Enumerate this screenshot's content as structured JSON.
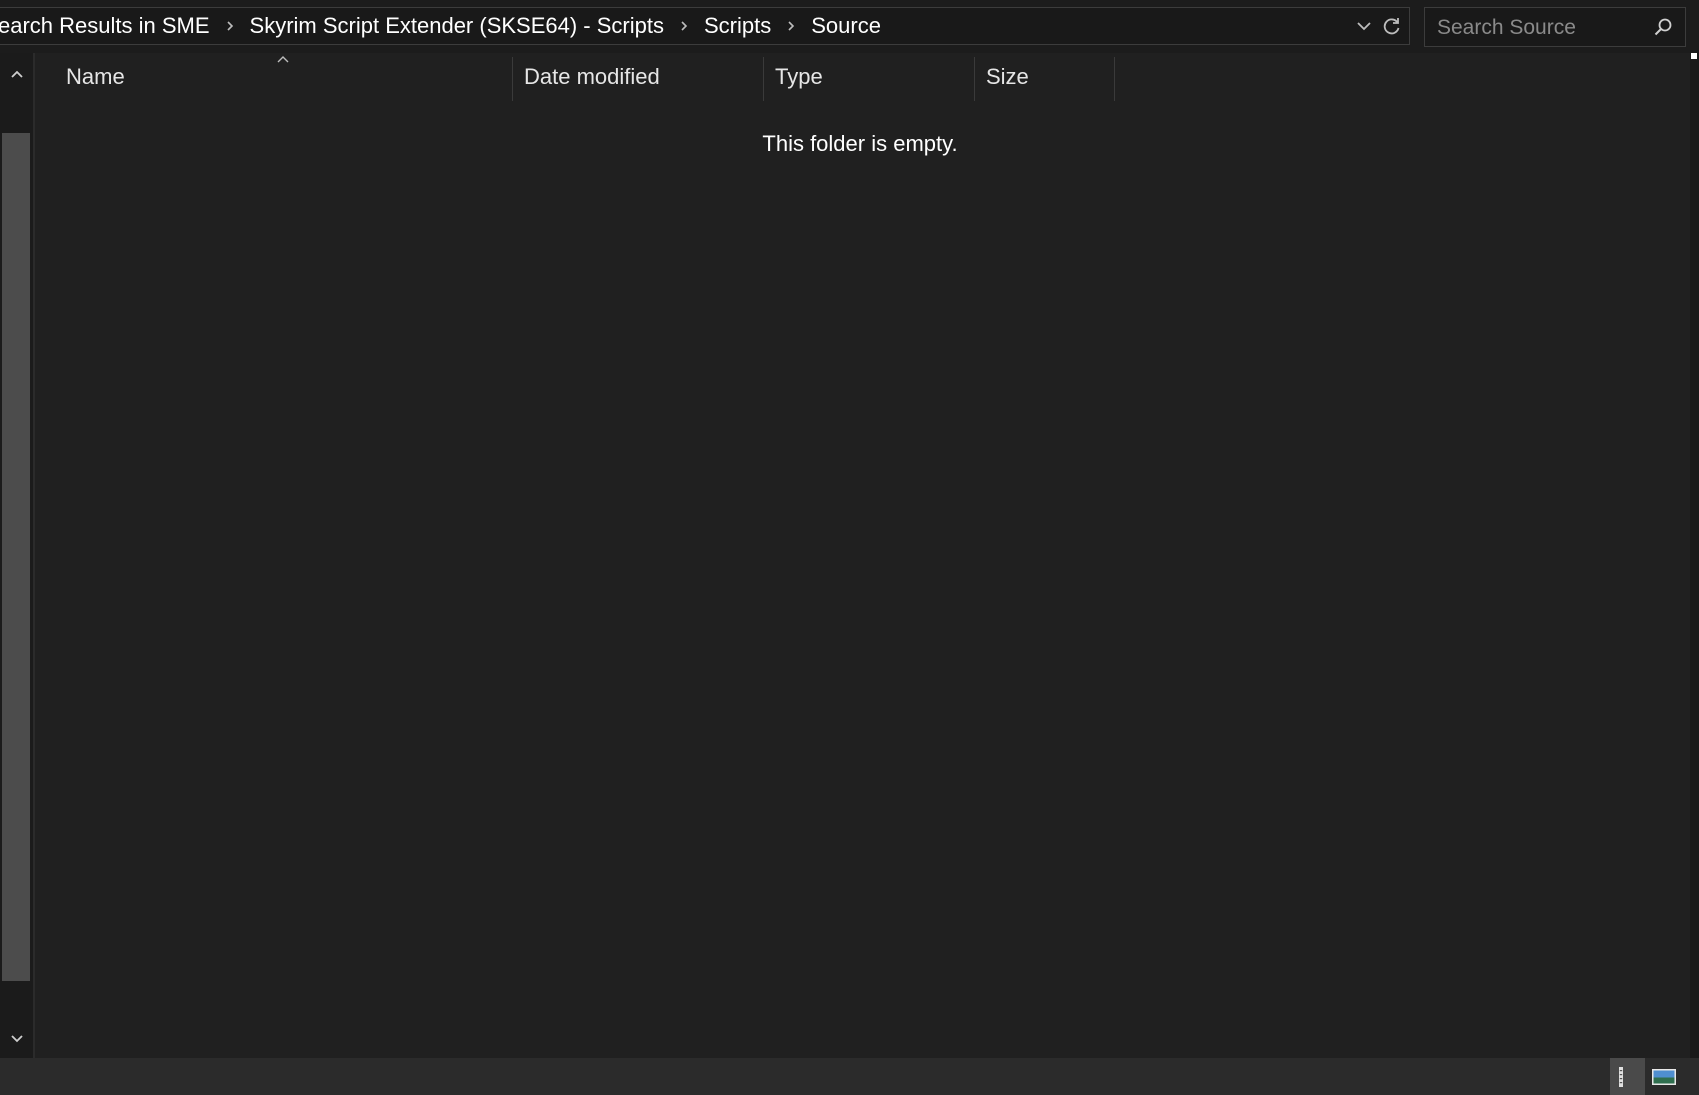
{
  "breadcrumb": {
    "items": [
      {
        "label": "earch Results in SME"
      },
      {
        "label": "Skyrim Script Extender (SKSE64) - Scripts"
      },
      {
        "label": "Scripts"
      },
      {
        "label": "Source"
      }
    ]
  },
  "search": {
    "placeholder": "Search Source",
    "value": ""
  },
  "columns": {
    "name": "Name",
    "date_modified": "Date modified",
    "type": "Type",
    "size": "Size",
    "sort_column": "Name",
    "sort_direction": "ascending"
  },
  "main": {
    "empty_message": "This folder is empty."
  },
  "icons": {
    "breadcrumb_separator": "chevron-right-icon",
    "history_dropdown": "chevron-down-icon",
    "refresh": "refresh-icon",
    "search": "search-icon",
    "scroll_up": "chevron-up-icon",
    "scroll_down": "chevron-down-icon",
    "details_view": "details-view-icon",
    "tiles_view": "large-icons-view-icon"
  },
  "colors": {
    "background": "#202020",
    "bar_background": "#191919",
    "border": "#3c3c3c",
    "text": "#ffffff",
    "placeholder": "#8a8a8a",
    "status_bar": "#2b2b2b",
    "scroll_thumb": "#4c4c4c"
  }
}
